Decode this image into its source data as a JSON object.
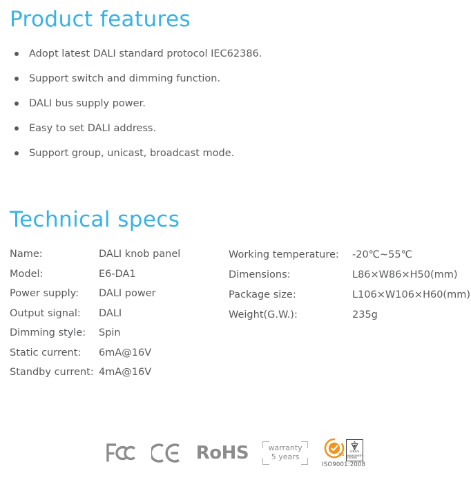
{
  "sections": {
    "features": {
      "heading": "Product features",
      "items": [
        "Adopt latest DALI standard protocol IEC62386.",
        "Support switch and dimming function.",
        "DALI bus supply power.",
        "Easy to set DALI address.",
        "Support group, unicast, broadcast mode."
      ]
    },
    "specs": {
      "heading": "Technical specs",
      "left_column": [
        {
          "label": "Name:",
          "value": "DALI knob panel"
        },
        {
          "label": "Model:",
          "value": "E6-DA1"
        },
        {
          "label": "Power supply:",
          "value": "DALI power"
        },
        {
          "label": "Output signal:",
          "value": "DALI"
        },
        {
          "label": "Dimming style:",
          "value": "Spin"
        },
        {
          "label": "Static current:",
          "value": "6mA@16V"
        },
        {
          "label": "Standby current:",
          "value": "4mA@16V"
        }
      ],
      "right_column": [
        {
          "label": "Working temperature:",
          "value": "-20℃~55℃"
        },
        {
          "label": "Dimensions:",
          "value": "L86×W86×H50(mm)"
        },
        {
          "label": "Package size:",
          "value": "L106×W106×H60(mm)"
        },
        {
          "label": "Weight(G.W.):",
          "value": "235g"
        }
      ]
    }
  },
  "certifications": {
    "fcc_label": "FC",
    "ce_label": "CE",
    "rohs_label": "RoHS",
    "warranty_line1": "warranty",
    "warranty_line2": "5 years",
    "iso_label": "ISO9001:2008",
    "ukas_label": "UKAS",
    "ukas_sub": "MANAGEMENT SYSTEMS"
  },
  "colors": {
    "heading_blue": "#35b3e8",
    "body_gray": "#58595b",
    "cert_gray": "#8c8c8c",
    "sgs_orange": "#f0941e",
    "background": "#ffffff"
  }
}
